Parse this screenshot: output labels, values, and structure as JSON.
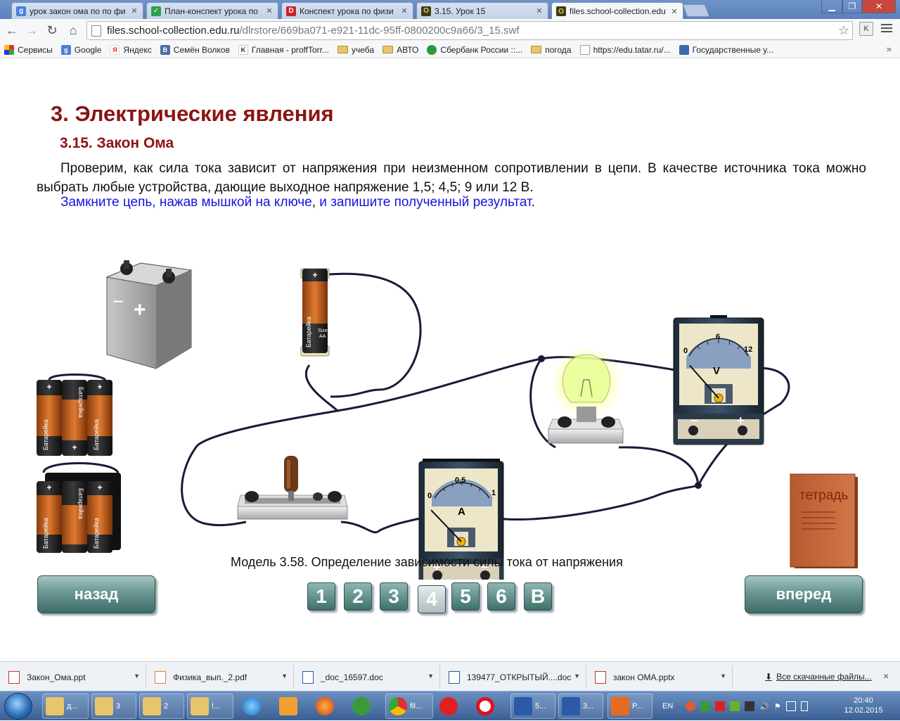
{
  "browser": {
    "tabs": [
      {
        "title": "урок закон ома по по фи",
        "favicon_color": "#4a7fe0",
        "favicon_letter": "g",
        "active": false
      },
      {
        "title": "План-конспект урока по",
        "favicon_color": "#2aa04a",
        "favicon_letter": "✓",
        "active": false
      },
      {
        "title": "Конспект урока по физи",
        "favicon_color": "#d0202a",
        "favicon_letter": "D",
        "active": false
      },
      {
        "title": "3.15. Урок 15",
        "favicon_color": "#3a3a1a",
        "favicon_letter": "O",
        "active": false
      },
      {
        "title": "files.school-collection.edu",
        "favicon_color": "#3a3a1a",
        "favicon_letter": "O",
        "active": true
      }
    ],
    "url_host": "files.school-collection.edu.ru",
    "url_path": "/dlrstore/669ba071-e921-11dc-95ff-0800200c9a66/3_15.swf",
    "extension_label": "K",
    "bookmarks": [
      {
        "label": "Сервисы",
        "icon": "apps-icon",
        "color": "#d33"
      },
      {
        "label": "Google",
        "icon": "google-icon",
        "color": "#4a7fe0"
      },
      {
        "label": "Яндекс",
        "icon": "yandex-icon",
        "color": "#e22"
      },
      {
        "label": "Семён Волков",
        "icon": "vk-icon",
        "color": "#4a6ea0"
      },
      {
        "label": "Главная - proffTorr...",
        "icon": "torrent-icon",
        "color": "#333"
      },
      {
        "label": "учеба",
        "icon": "folder-icon",
        "color": "#e8c46a"
      },
      {
        "label": "АВТО",
        "icon": "folder-icon",
        "color": "#e8c46a"
      },
      {
        "label": "Сбербанк России ::...",
        "icon": "sberbank-icon",
        "color": "#2a9a3a"
      },
      {
        "label": "погода",
        "icon": "folder-icon",
        "color": "#e8c46a"
      },
      {
        "label": "https://edu.tatar.ru/...",
        "icon": "page-icon",
        "color": "#999"
      },
      {
        "label": "Государственные у...",
        "icon": "gosuslugi-icon",
        "color": "#3a6ab0"
      }
    ],
    "bookmarks_more": "»"
  },
  "lesson": {
    "chapter_title": "3. Электрические явления",
    "section_title": "3.15. Закон Ома",
    "intro": "Проверим, как сила тока зависит от напряжения при неизменном сопротивлении в цепи. В качестве источника тока можно выбрать любые устройства, дающие выходное напряжение 1,5; 4,5; 9 или 12 В.",
    "instruction_part1": "Замкните цепь, нажав мышкой на ключе",
    "instruction_sep": ",",
    "instruction_part2": " и запишите полученный результат",
    "instruction_end": ".",
    "caption": "Модель 3.58. Определение зависимости силы тока от напряжения"
  },
  "simulation": {
    "battery_label": "Батарейка",
    "battery_size": "Size",
    "battery_type": "AA",
    "plus_sign": "+",
    "minus_sign": "−",
    "ammeter": {
      "letter": "A",
      "scale_min": "0",
      "scale_mid": "0,5",
      "scale_max": "1",
      "reading_fraction": 0.12
    },
    "voltmeter": {
      "letter": "V",
      "scale_min": "0",
      "scale_mid": "6",
      "scale_max": "12",
      "reading_fraction": 0.14
    },
    "notebook_label": "тетрадь"
  },
  "navigation": {
    "back_label": "назад",
    "forward_label": "вперед",
    "pages": [
      "1",
      "2",
      "3",
      "4",
      "5",
      "6",
      "В"
    ],
    "current_page": "4"
  },
  "downloads": {
    "items": [
      {
        "name": "Закон_Ома.ppt",
        "color": "#c0392b"
      },
      {
        "name": "Физика_вып._2.pdf",
        "color": "#e67e22"
      },
      {
        "name": "_doc_16597.doc",
        "color": "#2a5aa8"
      },
      {
        "name": "139477_ОТКРЫТЫЙ....doc",
        "color": "#2a5aa8"
      },
      {
        "name": "закон ОМА.pptx",
        "color": "#c0392b"
      }
    ],
    "show_all": "Все скачанные файлы...",
    "close": "×"
  },
  "taskbar": {
    "items": [
      {
        "label": "д...",
        "icon": "folder-icon"
      },
      {
        "label": "3",
        "icon": "folder-icon"
      },
      {
        "label": "2",
        "icon": "folder-icon"
      },
      {
        "label": "!...",
        "icon": "folder-icon"
      },
      {
        "label": "",
        "icon": "ie-icon"
      },
      {
        "label": "",
        "icon": "media-player-icon"
      },
      {
        "label": "",
        "icon": "firefox-icon"
      },
      {
        "label": "",
        "icon": "utorrent-icon"
      },
      {
        "label": "fil...",
        "icon": "chrome-icon"
      },
      {
        "label": "",
        "icon": "yandex-browser-icon"
      },
      {
        "label": "",
        "icon": "opera-icon"
      },
      {
        "label": "5...",
        "icon": "word-icon"
      },
      {
        "label": "3...",
        "icon": "word-icon"
      },
      {
        "label": "P...",
        "icon": "pdf-icon"
      }
    ],
    "language": "EN",
    "time": "20:40",
    "date": "12.02.2015"
  }
}
